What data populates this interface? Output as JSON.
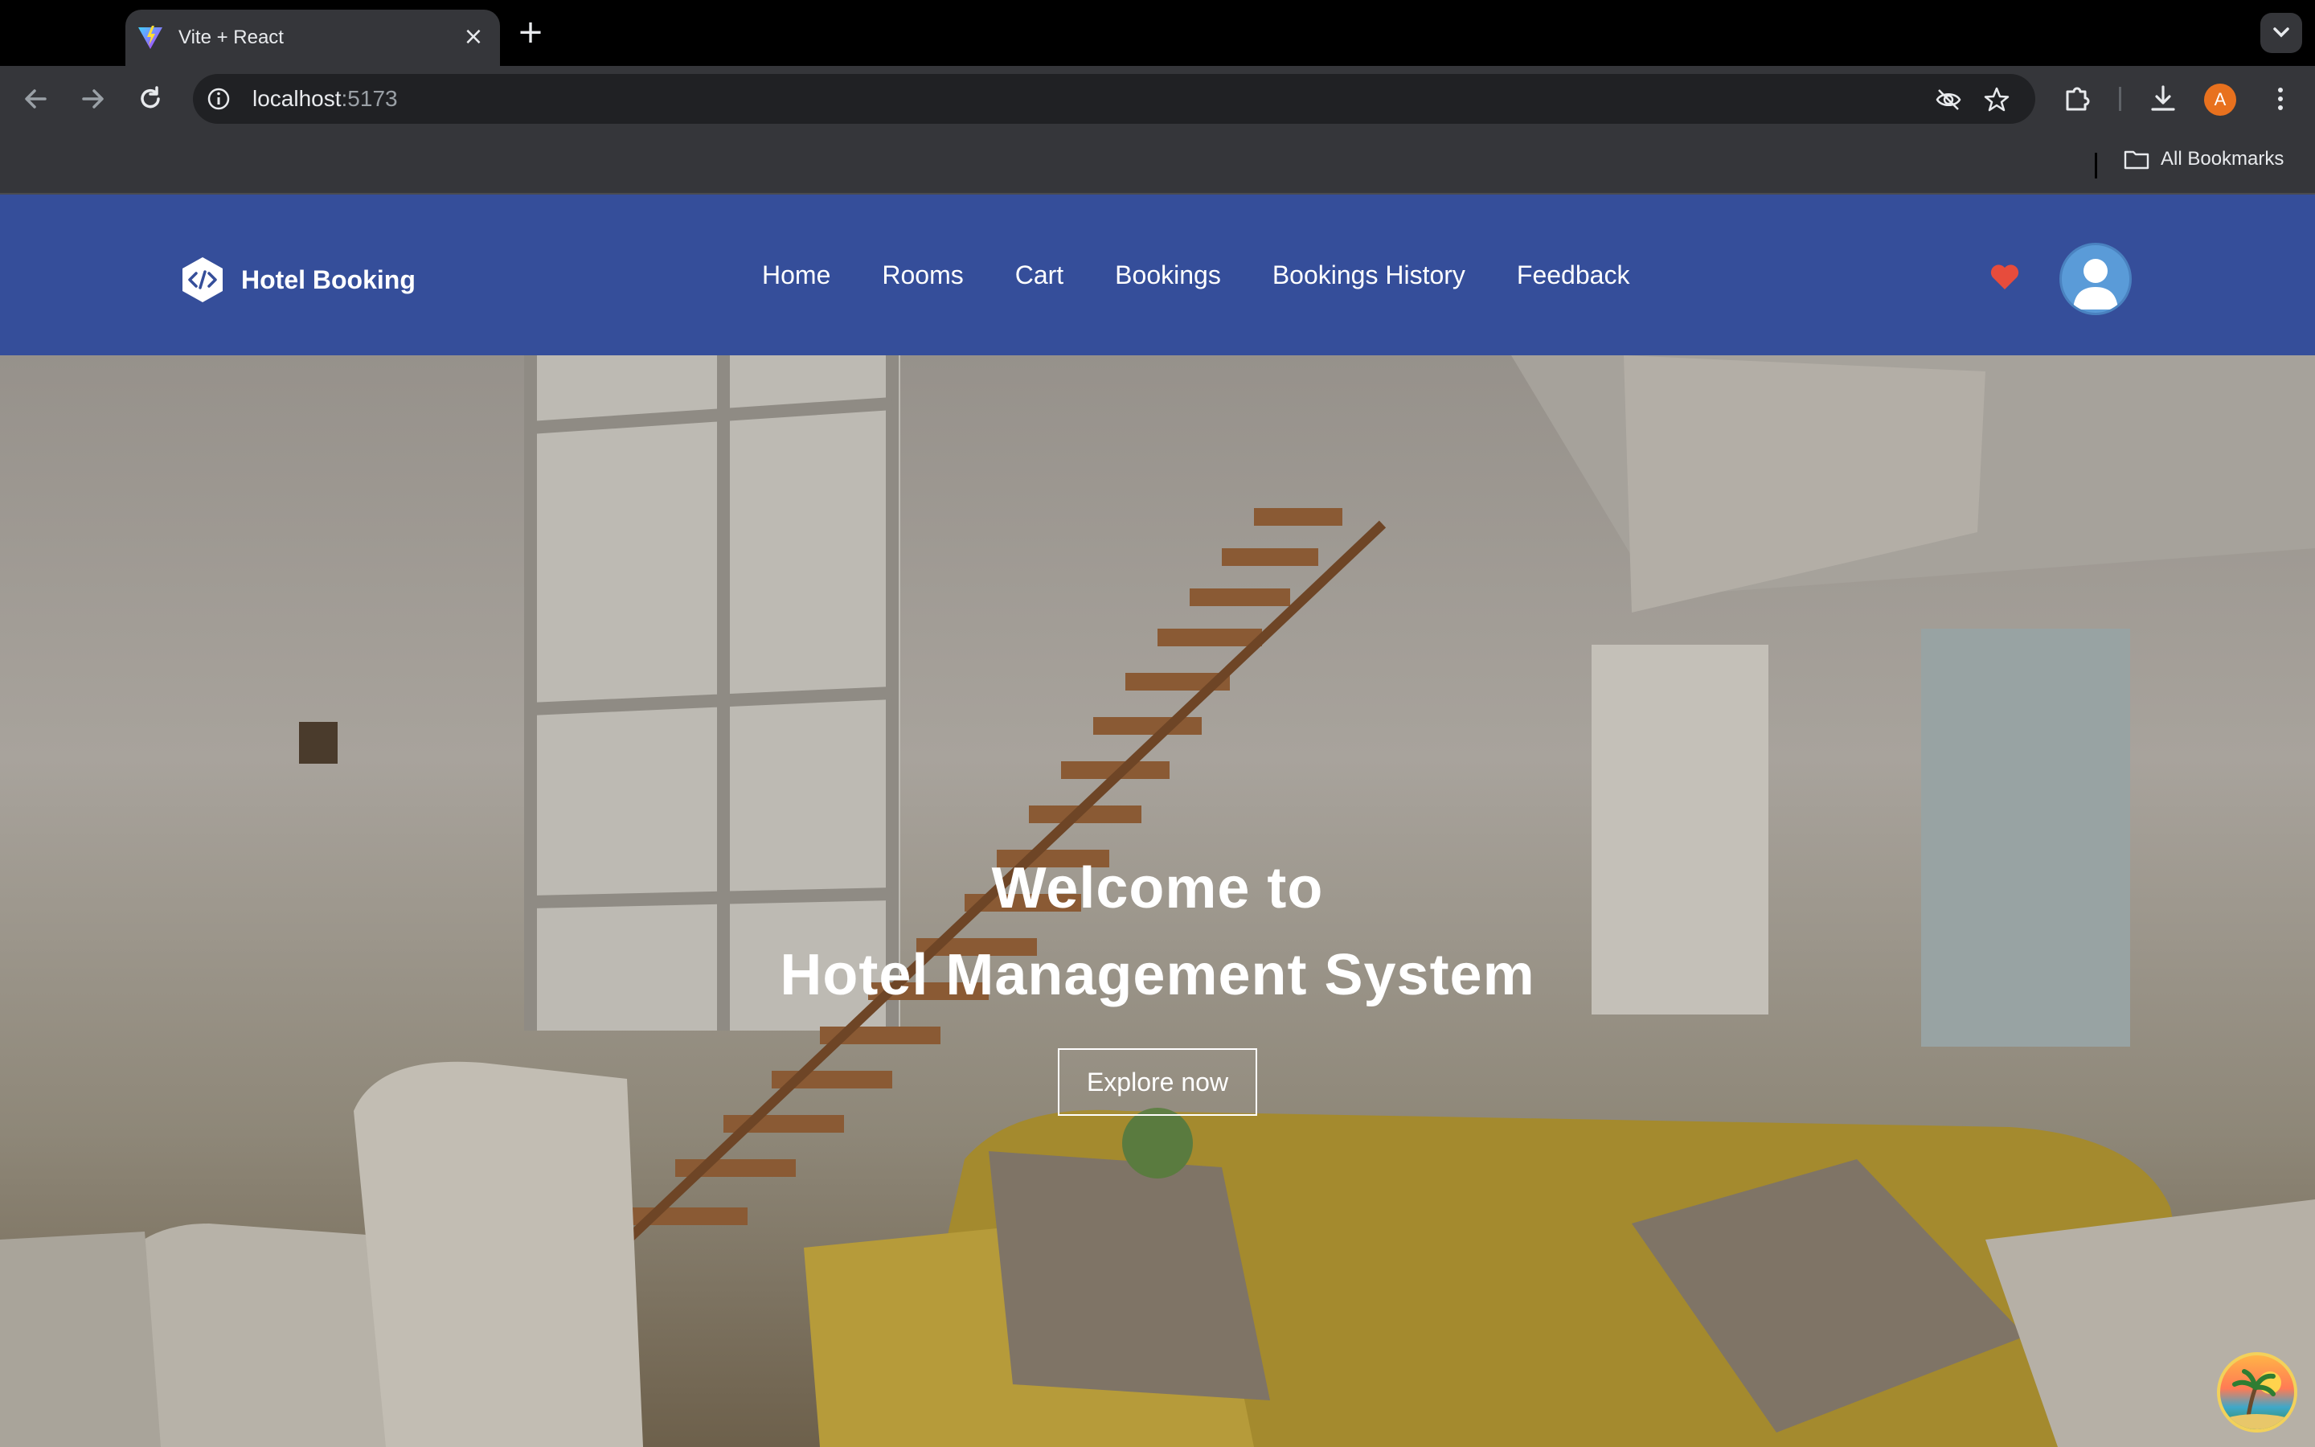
{
  "browser": {
    "tab_title": "Vite + React",
    "url_host": "localhost",
    "url_port": ":5173",
    "profile_initial": "A",
    "bookmarks_label": "All Bookmarks"
  },
  "site": {
    "brand": "Hotel Booking",
    "nav": [
      "Home",
      "Rooms",
      "Cart",
      "Bookings",
      "Bookings History",
      "Feedback"
    ],
    "colors": {
      "navbar": "#354e9a",
      "heart": "#e74c3c"
    }
  },
  "hero": {
    "line1": "Welcome to",
    "line2": "Hotel Management System",
    "cta": "Explore now"
  }
}
